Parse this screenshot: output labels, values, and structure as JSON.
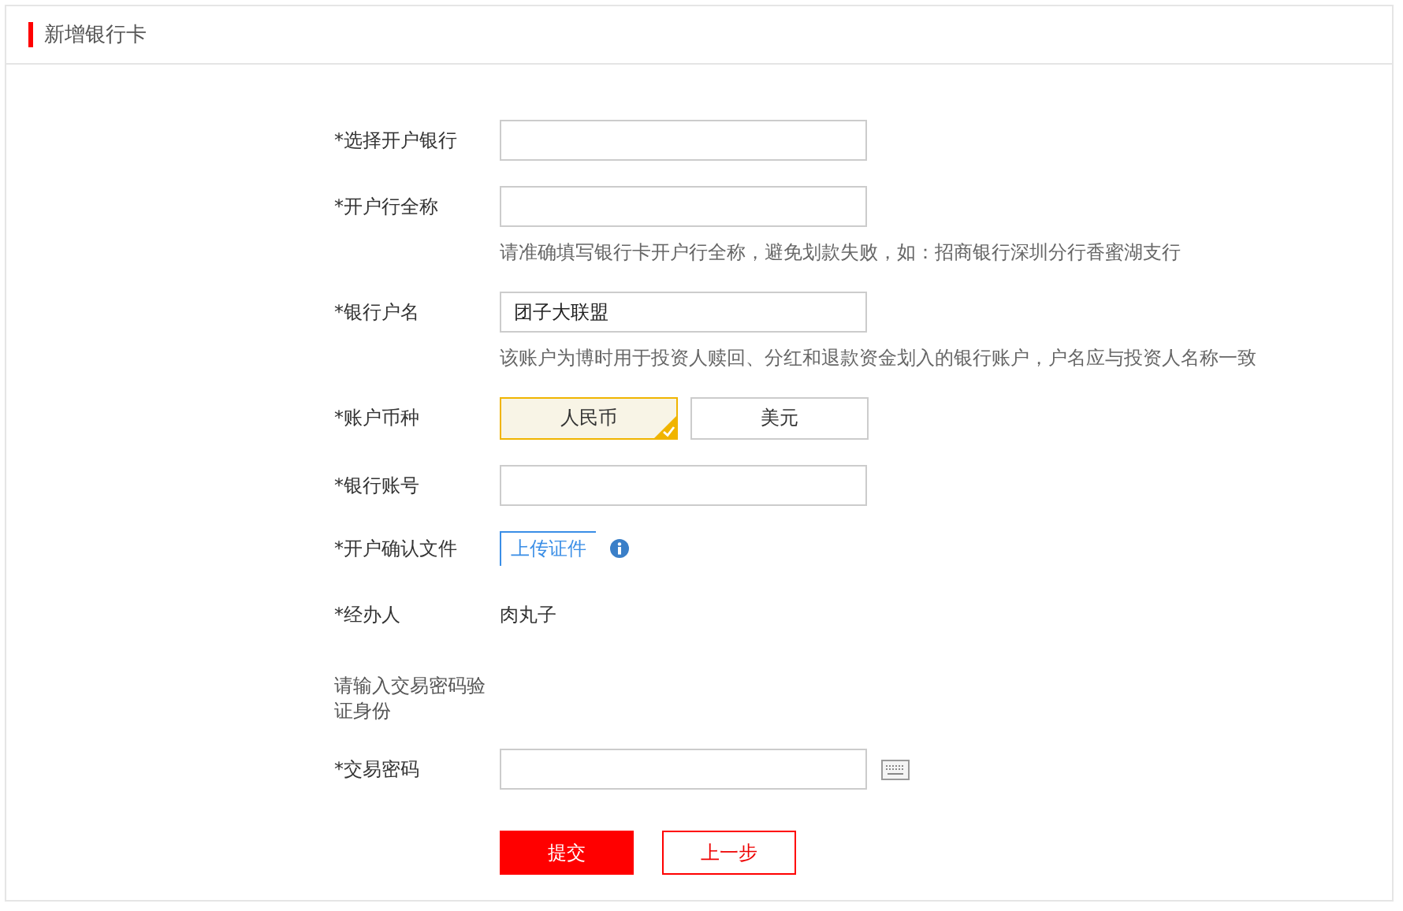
{
  "title": "新增银行卡",
  "fields": [
    {
      "kind": "input",
      "label": "*选择开户银行"
    },
    {
      "kind": "input",
      "label": "*开户行全称",
      "hint": "请准确填写银行卡开户行全称，避免划款失败，如：招商银行深圳分行香蜜湖支行"
    },
    {
      "kind": "input",
      "label": "*银行户名",
      "value": "团子大联盟",
      "hint": "该账户为博时用于投资人赎回、分红和退款资金划入的银行账户，户名应与投资人名称一致"
    },
    {
      "kind": "currency",
      "label": "*账户币种",
      "options": [
        {
          "label": "人民币",
          "selected": true
        },
        {
          "label": "美元",
          "selected": false
        }
      ]
    },
    {
      "kind": "input",
      "label": "*银行账号"
    },
    {
      "kind": "upload",
      "label": "*开户确认文件",
      "button": "上传证件"
    },
    {
      "kind": "text",
      "label": "*经办人",
      "value": "肉丸子"
    },
    {
      "kind": "note",
      "text": "请输入交易密码验证身份"
    },
    {
      "kind": "password",
      "label": "*交易密码"
    }
  ],
  "buttons": [
    {
      "label": "提交",
      "kind": "primary"
    },
    {
      "label": "上一步",
      "kind": "secondary"
    }
  ]
}
